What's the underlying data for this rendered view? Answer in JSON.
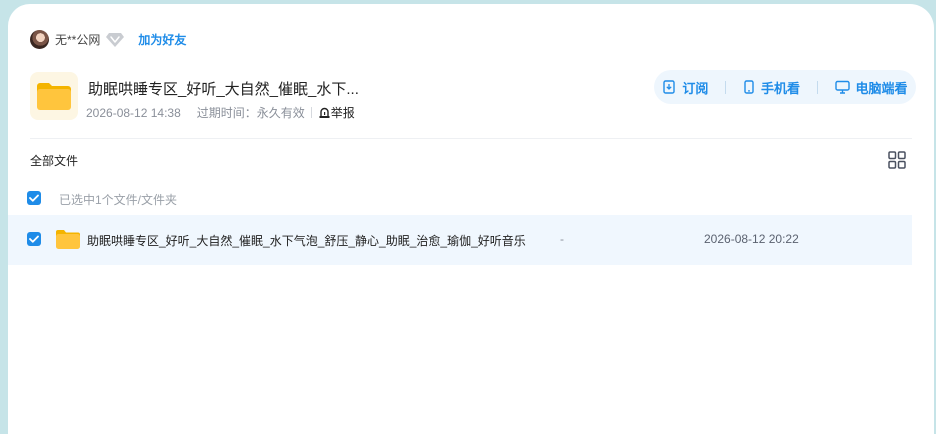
{
  "owner": {
    "name": "无**公网",
    "add_friend": "加为好友"
  },
  "share": {
    "title": "助眠哄睡专区_好听_大自然_催眠_水下...",
    "created": "2026-08-12 14:38",
    "expiry_label": "过期时间：",
    "expiry_value": "永久有效",
    "report": "举报"
  },
  "actions": {
    "subscribe": "订阅",
    "phone": "手机看",
    "pc": "电脑端看"
  },
  "toolbar": {
    "breadcrumb": "全部文件"
  },
  "selection": {
    "text": "已选中1个文件/文件夹"
  },
  "files": [
    {
      "name": "助眠哄睡专区_好听_大自然_催眠_水下气泡_舒压_静心_助眠_治愈_瑜伽_好听音乐",
      "size": "-",
      "date": "2026-08-12 20:22",
      "selected": true
    }
  ],
  "colors": {
    "accent": "#1f8ce8",
    "row_selected_bg": "#f0f7fe",
    "folder": "#ffc53d",
    "page_bg": "#c6e4e8"
  }
}
